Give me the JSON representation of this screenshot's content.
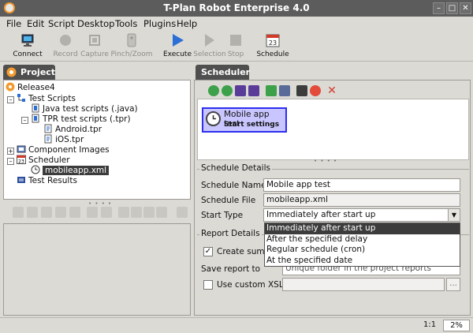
{
  "window": {
    "title": "T-Plan Robot Enterprise 4.0"
  },
  "menu": [
    "File",
    "Edit",
    "Script",
    "Desktop",
    "Tools",
    "Plugins",
    "Help"
  ],
  "toolbar": {
    "connect": "Connect",
    "record": "Record",
    "capture": "Capture",
    "pinch": "Pinch/Zoom",
    "execute": "Execute",
    "selection": "Selection",
    "stop": "Stop",
    "schedule": "Schedule",
    "schedule_day": "23"
  },
  "project": {
    "tab": "Project",
    "tree": {
      "root": "Release4",
      "test_scripts": "Test Scripts",
      "java": "Java test scripts (.java)",
      "tpr": "TPR test scripts (.tpr)",
      "android": "Android.tpr",
      "ios": "iOS.tpr",
      "component_images": "Component Images",
      "scheduler": "Scheduler",
      "scheduler_day": "23",
      "mobileapp": "mobileapp.xml",
      "test_results": "Test Results"
    }
  },
  "scheduler": {
    "tab": "Scheduler",
    "task": {
      "name": "Mobile app test",
      "subtitle": "Start settings"
    },
    "details": {
      "title": "Schedule Details",
      "name_label": "Schedule Name",
      "name_value": "Mobile app test",
      "file_label": "Schedule File",
      "file_value": "mobileapp.xml",
      "start_label": "Start Type",
      "start_value": "Immediately after start up",
      "start_options": [
        "Immediately after start up",
        "After the specified delay",
        "Regular schedule (cron)",
        "At the specified date"
      ]
    },
    "report": {
      "title": "Report Details",
      "create_label": "Create summ",
      "save_label": "Save report to",
      "save_value": "Unique folder in the project reports",
      "xsl_label": "Use custom XSL",
      "browse": "..."
    }
  },
  "status": {
    "position": "1:1",
    "zoom": "2%"
  },
  "colors": {
    "selection": "#3c3c3c",
    "task_fill": "#c9c6ff",
    "task_border": "#2e2ef0",
    "accent": "#f29a2e"
  }
}
